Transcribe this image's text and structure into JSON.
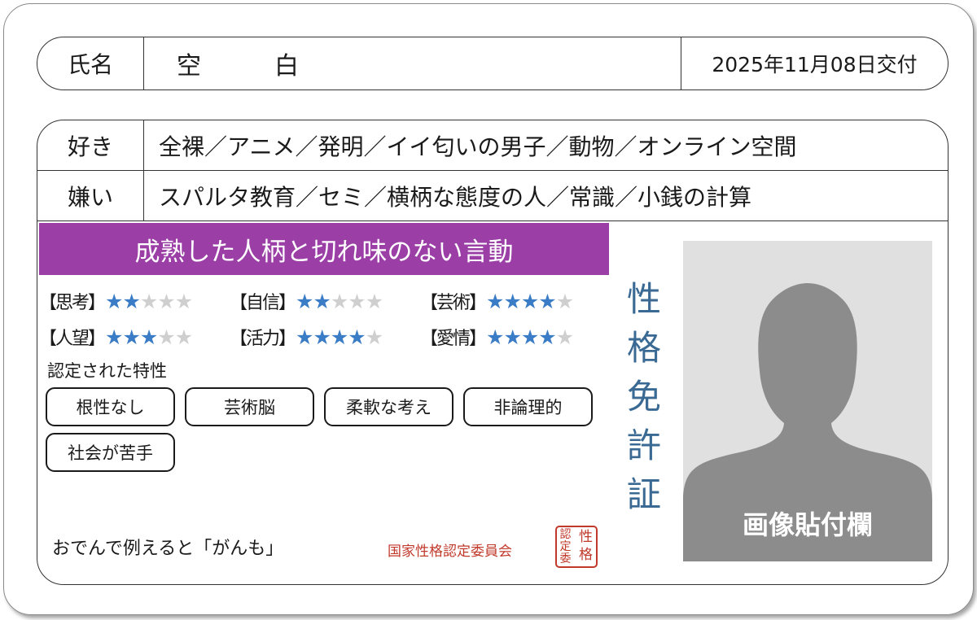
{
  "name_section": {
    "label": "氏名",
    "value": "空白",
    "issue_date": "2025年11月08日交付"
  },
  "likes": {
    "label": "好き",
    "value": "全裸／アニメ／発明／イイ匂いの男子／動物／オンライン空間"
  },
  "dislikes": {
    "label": "嫌い",
    "value": "スパルタ教育／セミ／横柄な態度の人／常識／小銭の計算"
  },
  "banner": "成熟した人柄と切れ味のない言動",
  "banner_color": "#9b3fa7",
  "star_on_color": "#3a7cc6",
  "star_off_color": "#cfcfcf",
  "title_color": "#3a6a94",
  "stats": [
    {
      "label": "【思考】",
      "rating": 2,
      "max": 5
    },
    {
      "label": "【自信】",
      "rating": 2,
      "max": 5
    },
    {
      "label": "【芸術】",
      "rating": 4,
      "max": 5
    },
    {
      "label": "【人望】",
      "rating": 3,
      "max": 5
    },
    {
      "label": "【活力】",
      "rating": 4,
      "max": 5
    },
    {
      "label": "【愛情】",
      "rating": 4,
      "max": 5
    }
  ],
  "traits_title": "認定された特性",
  "traits": [
    "根性なし",
    "芸術脳",
    "柔軟な考え",
    "非論理的",
    "社会が苦手"
  ],
  "vertical_title": [
    "性",
    "格",
    "免",
    "許",
    "証"
  ],
  "oden_text": "おでんで例えると「がんも」",
  "committee": "国家性格認定委員会",
  "seal_chars": [
    "認",
    "性",
    "定",
    "格",
    "委"
  ],
  "seal_color": "#c0392b",
  "photo_label": "画像貼付欄",
  "photo_icon": "person-silhouette-icon"
}
